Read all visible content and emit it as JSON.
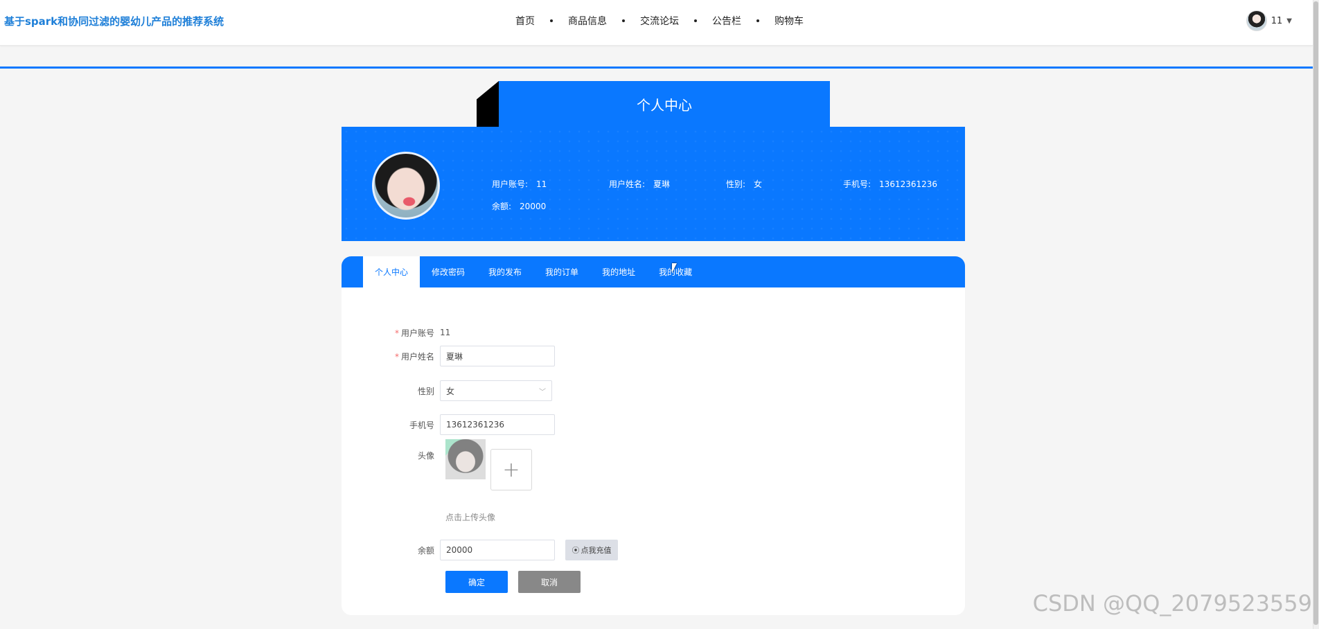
{
  "header": {
    "brand": "基于spark和协同过滤的婴幼儿产品的推荐系统",
    "nav": [
      "首页",
      "商品信息",
      "交流论坛",
      "公告栏",
      "购物车"
    ],
    "username": "11"
  },
  "page_title": "个人中心",
  "profile": {
    "account_label": "用户账号:",
    "account": "11",
    "name_label": "用户姓名:",
    "name": "夏琳",
    "gender_label": "性别:",
    "gender": "女",
    "phone_label": "手机号:",
    "phone": "13612361236",
    "balance_label": "余额:",
    "balance": "20000"
  },
  "tabs": [
    "个人中心",
    "修改密码",
    "我的发布",
    "我的订单",
    "我的地址",
    "我的收藏"
  ],
  "form": {
    "account_label": "用户账号",
    "account_value": "11",
    "name_label": "用户姓名",
    "name_value": "夏琳",
    "gender_label": "性别",
    "gender_value": "女",
    "phone_label": "手机号",
    "phone_value": "13612361236",
    "avatar_label": "头像",
    "upload_hint": "点击上传头像",
    "balance_label": "余额",
    "balance_value": "20000",
    "recharge_label": "点我充值",
    "confirm_label": "确定",
    "cancel_label": "取消"
  },
  "watermark": "CSDN @QQ_2079523559",
  "colors": {
    "primary": "#0a78ff",
    "brand_text": "#1e7fd8",
    "cancel": "#888888"
  }
}
